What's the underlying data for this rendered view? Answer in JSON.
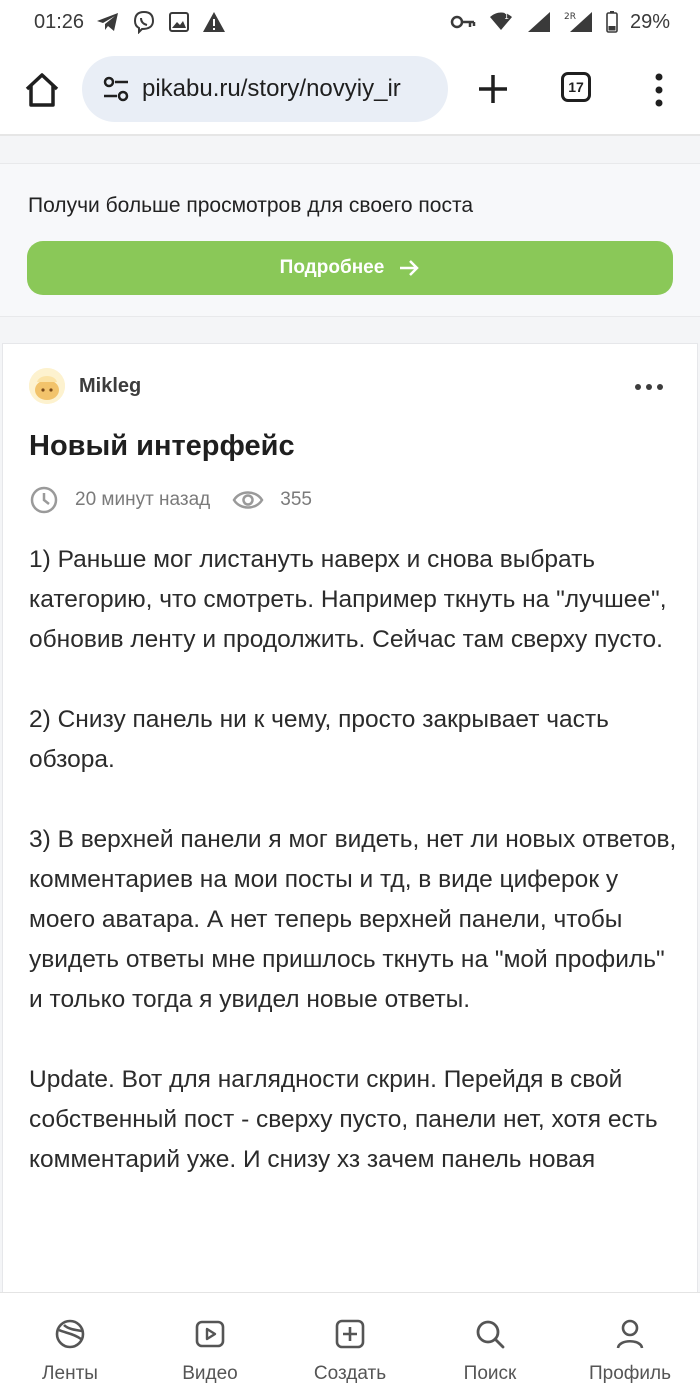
{
  "status_bar": {
    "time": "01:26",
    "battery": "29%",
    "sim_badge": "1",
    "network_badge": "2R"
  },
  "browser": {
    "url": "pikabu.ru/story/novyiy_ir",
    "tab_count": "17"
  },
  "promo": {
    "text": "Получи больше просмотров для своего поста",
    "button_label": "Подробнее",
    "button_color": "#8ac858"
  },
  "post": {
    "author": "Mikleg",
    "title": "Новый интерфейс",
    "time_ago": "20 минут назад",
    "views": "355",
    "paragraphs": [
      "1) Раньше мог листануть наверх и снова выбрать категорию, что смотреть. Например ткнуть на \"лучшее\", обновив ленту и продолжить. Сейчас там сверху пусто.",
      "2) Снизу панель ни к чему, просто закрывает часть обзора.",
      "3) В верхней панели я мог видеть, нет ли новых ответов, комментариев на мои посты и тд, в виде циферок у моего аватара. А нет теперь верхней панели, чтобы увидеть ответы мне пришлось ткнуть на \"мой профиль\" и только тогда я увидел новые ответы.",
      "Update. Вот для наглядности скрин. Перейдя в свой собственный пост - сверху пусто, панели нет, хотя есть комментарий уже. И снизу хз зачем панель новая"
    ]
  },
  "bottom_nav": {
    "items": [
      {
        "label": "Ленты",
        "icon": "feeds-icon"
      },
      {
        "label": "Видео",
        "icon": "video-icon"
      },
      {
        "label": "Создать",
        "icon": "create-icon"
      },
      {
        "label": "Поиск",
        "icon": "search-icon"
      },
      {
        "label": "Профиль",
        "icon": "profile-icon"
      }
    ]
  }
}
